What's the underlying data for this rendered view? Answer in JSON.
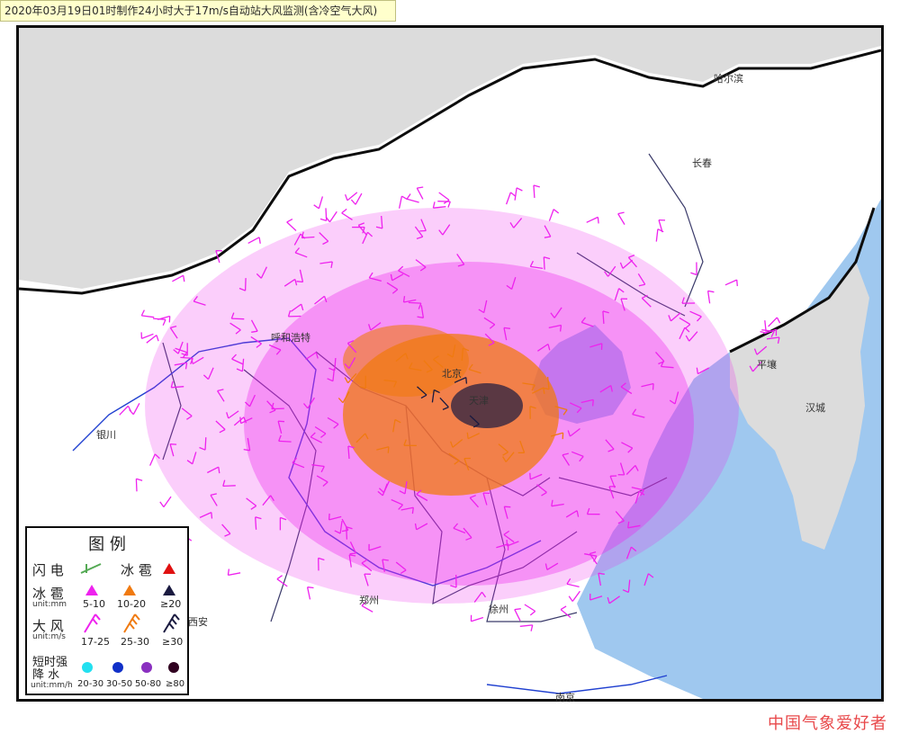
{
  "header": {
    "title": "2020年03月19日01时制作24小时大于17m/s自动站大风监测(含冷空气大风)"
  },
  "map": {
    "cities": [
      "哈尔滨",
      "长春",
      "平壤",
      "汉城",
      "呼和浩特",
      "银川",
      "北京",
      "天津",
      "郑州",
      "徐州",
      "西安",
      "南京"
    ],
    "colors": {
      "land_white": "#ffffff",
      "land_gray": "#dcdcdc",
      "sea": "#9fc8ef",
      "border": "#0d0d0d",
      "province": "#3a3a6a",
      "river": "#2040d0",
      "wind_17_25": "#ee22ee",
      "wind_25_30": "#f07a10",
      "wind_ge30": "#1a1a40"
    }
  },
  "legend": {
    "title": "图 例",
    "lightning_label": "闪 电",
    "hail_label_top": "冰 雹",
    "hail_label": "冰 雹",
    "hail_unit": "unit:mm",
    "hail_values": [
      "5-10",
      "10-20",
      "≥20"
    ],
    "wind_label": "大 风",
    "wind_unit": "unit:m/s",
    "wind_values": [
      "17-25",
      "25-30",
      "≥30"
    ],
    "rain_label_1": "短时强",
    "rain_label_2": "降 水",
    "rain_unit": "unit:mm/h",
    "rain_values": [
      "20-30",
      "30-50",
      "50-80",
      "≥80"
    ],
    "colors": {
      "hail_red": "#e01010",
      "hail_5_10": "#ee22ee",
      "hail_10_20": "#f07a10",
      "hail_ge20": "#1a1a40",
      "rain_20_30": "#22e0f0",
      "rain_30_50": "#1030c8",
      "rain_50_80": "#8a30c0",
      "rain_ge80": "#300020",
      "lightning": "#55aa55"
    }
  },
  "watermark": "中国气象爱好者"
}
